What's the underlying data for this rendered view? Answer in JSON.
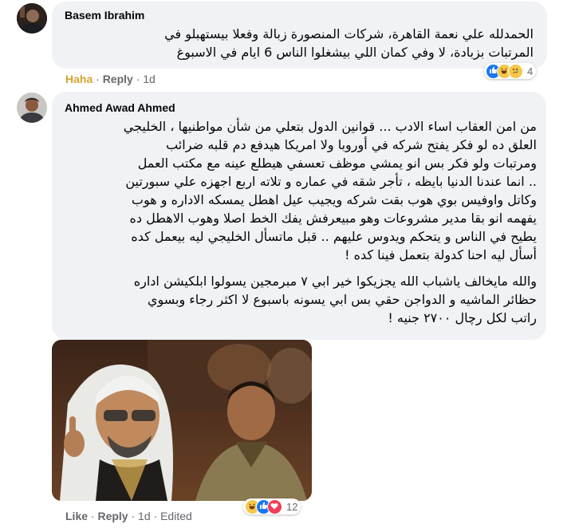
{
  "comments": [
    {
      "author": "Basem Ibrahim",
      "text_lines": [
        "الحمدلله علي نعمة القاهرة، شركات المنصورة زبالة وفعلا بيستهبلو في",
        "المرتبات بزبادة، لا وفي كمان اللي بيشغلوا الناس 6 ايام في الاسبوغ"
      ],
      "actions": {
        "react": "Haha",
        "reply": "Reply",
        "time": "1d"
      },
      "reactions": {
        "icons": [
          "like-icon",
          "haha-icon",
          "sad-icon"
        ],
        "count": "4"
      }
    },
    {
      "author": "Ahmed Awad Ahmed",
      "paragraph1": [
        "من امن العقاب اساء الادب ... قوانين الدول بتعلي من شأن مواطنيها ، الخليجي",
        "العلق ده لو فكر يفتح شركه في أوروبا ولا امريكا هيدفع دم قلبه ضرائب",
        "ومرتبات ولو فكر بس انو يمشي موظف تعسفي هيطلع عينه مع مكتب العمل",
        ".. انما عندنا الدنيا بايظه ، تأجر شقه في عماره و تلاته اربع اجهزه علي سبورتين",
        "وكاتل واوفيس بوي هوب بقت شركه ويجيب عيل اهطل يمسكه الاداره و هوب",
        "يفهمه انو بقا مدير مشروعات وهو مبيعرفش يفك الخط اصلا وهوب الاهطل ده",
        "يطيح في الناس و يتحكم ويدوس عليهم .. قبل ماتسأل الخليجي ليه بيعمل كده",
        "أسأل ليه احنا كدولة بتعمل فينا كده !"
      ],
      "paragraph2": [
        "والله مايخالف ياشباب الله يجزيكوا خير ابي ٧ مبرمجين يسولوا ابلكيشن اداره",
        "حظائر الماشيه و الدواجن حقي بس ابي يسونه باسبوع لا اكثر رجاء وبسوي",
        "راتب لكل رچال ٢٧٠٠ جنيه !"
      ],
      "actions": {
        "react": "Like",
        "reply": "Reply",
        "time": "1d",
        "edited": "Edited"
      },
      "reactions": {
        "icons": [
          "haha-icon",
          "like-icon",
          "love-icon"
        ],
        "count": "12"
      }
    }
  ],
  "colors": {
    "bubble": "#f0f2f5",
    "meta": "#65676b",
    "haha": "#d9a234",
    "like": "#1877f2",
    "love": "#f33e58"
  }
}
